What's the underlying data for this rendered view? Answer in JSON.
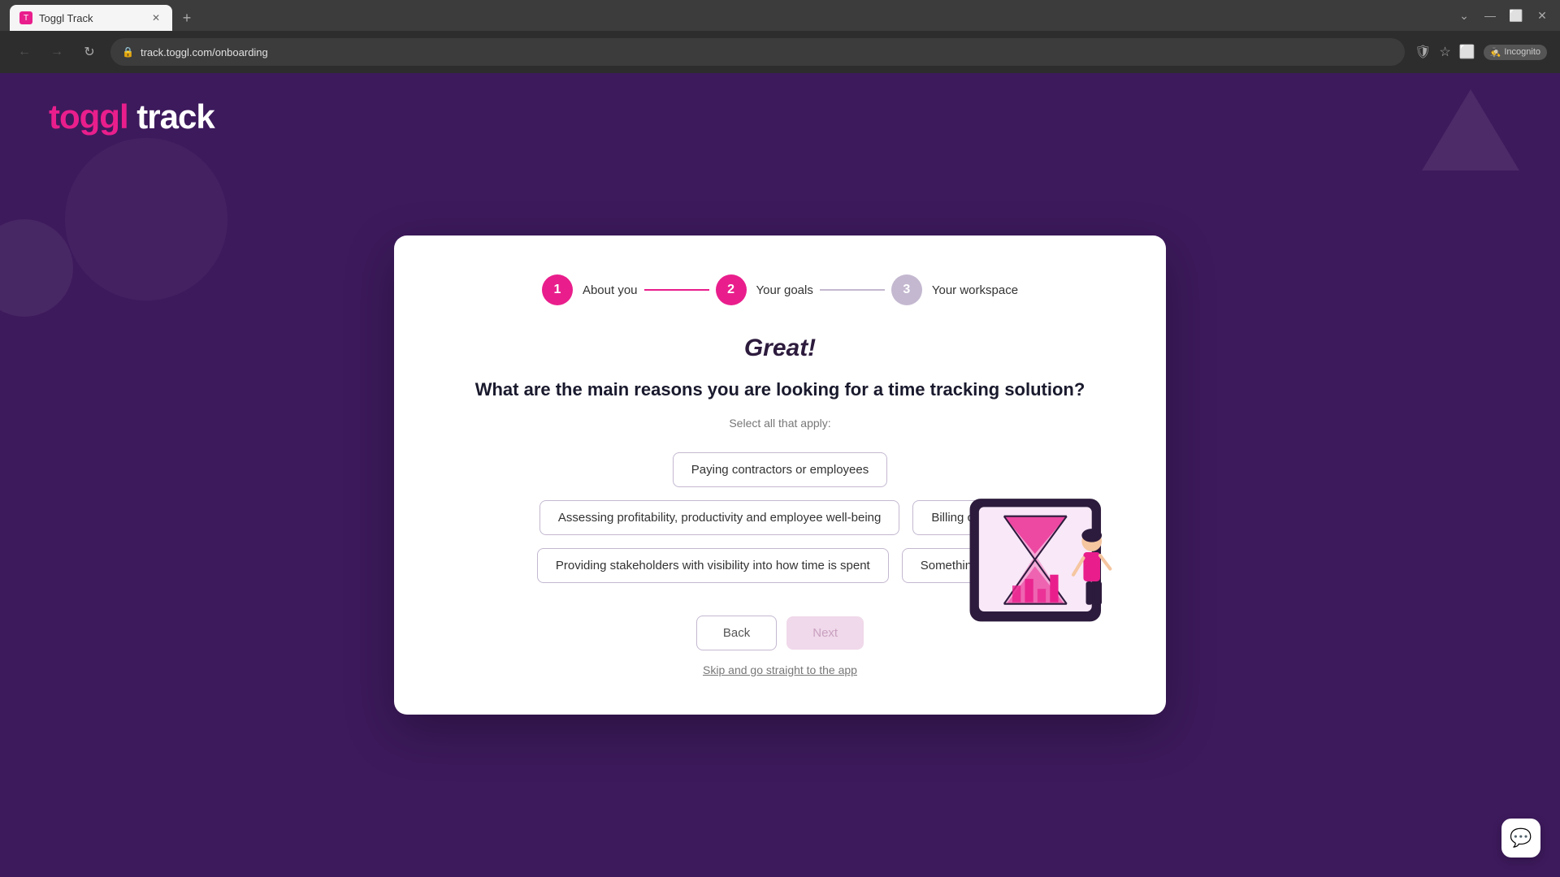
{
  "browser": {
    "tab_title": "Toggl Track",
    "url": "track.toggl.com/onboarding",
    "incognito_label": "Incognito"
  },
  "logo": {
    "toggl": "toggl",
    "track": " track"
  },
  "stepper": {
    "steps": [
      {
        "number": "1",
        "label": "About you",
        "state": "done"
      },
      {
        "number": "2",
        "label": "Your goals",
        "state": "active"
      },
      {
        "number": "3",
        "label": "Your workspace",
        "state": "inactive"
      }
    ],
    "connectors": [
      "done",
      "pending"
    ]
  },
  "content": {
    "great_title": "Great!",
    "question": "What are the main reasons you are looking for a time tracking solution?",
    "select_all_text": "Select all that apply:",
    "options": [
      {
        "id": "paying",
        "label": "Paying contractors or employees",
        "selected": false
      },
      {
        "id": "assessing",
        "label": "Assessing profitability, productivity and employee well-being",
        "selected": false
      },
      {
        "id": "billing",
        "label": "Billing clients",
        "selected": false
      },
      {
        "id": "stakeholders",
        "label": "Providing stakeholders with visibility into how time is spent",
        "selected": false
      },
      {
        "id": "something_else",
        "label": "Something else",
        "selected": false
      }
    ]
  },
  "buttons": {
    "back": "Back",
    "next": "Next",
    "skip": "Skip and go straight to the app"
  }
}
